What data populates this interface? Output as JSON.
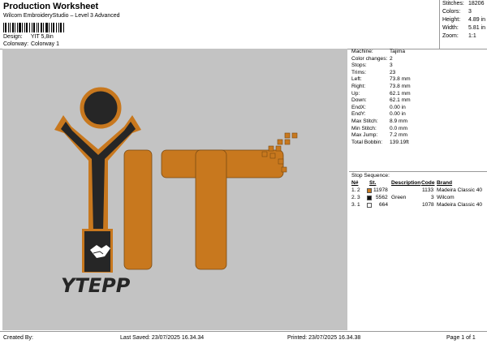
{
  "header": {
    "title": "Production Worksheet",
    "subtitle": "Wilcom EmbroideryStudio – Level 3 Advanced",
    "design_label": "Design:",
    "design_value": "YIT 5,8in",
    "colorway_label": "Colorway:",
    "colorway_value": "Colorway 1"
  },
  "stats": [
    {
      "label": "Stitches:",
      "value": "18206"
    },
    {
      "label": "Colors:",
      "value": "3"
    },
    {
      "label": "Height:",
      "value": "4.89 in"
    },
    {
      "label": "Width:",
      "value": "5.81 in"
    },
    {
      "label": "Zoom:",
      "value": "1:1"
    }
  ],
  "specs": [
    {
      "label": "Machine:",
      "value": "Tajima"
    },
    {
      "label": "Color changes:",
      "value": "2"
    },
    {
      "label": "Stops:",
      "value": "3"
    },
    {
      "label": "Trims:",
      "value": "23"
    },
    {
      "label": "Left:",
      "value": "73.8 mm"
    },
    {
      "label": "Right:",
      "value": "73.8 mm"
    },
    {
      "label": "Up:",
      "value": "62.1 mm"
    },
    {
      "label": "Down:",
      "value": "62.1 mm"
    },
    {
      "label": "EndX:",
      "value": "0.00 in"
    },
    {
      "label": "EndY:",
      "value": "0.00 in"
    },
    {
      "label": "Max Stitch:",
      "value": "8.9 mm"
    },
    {
      "label": "Min Stitch:",
      "value": "0.0 mm"
    },
    {
      "label": "Max Jump:",
      "value": "7.2 mm"
    },
    {
      "label": "Total Bobbin:",
      "value": "139.19ft"
    }
  ],
  "stop_sequence": {
    "title": "Stop Sequence:",
    "columns": [
      "N#",
      "St.",
      "Description",
      "Code",
      "Brand"
    ],
    "rows": [
      {
        "num": "1.",
        "stop": "2",
        "color": "#c87a1e",
        "code_no": "11978",
        "description": "",
        "code": "1133",
        "brand": "Madeira Classic 40"
      },
      {
        "num": "2.",
        "stop": "3",
        "color": "#111111",
        "code_no": "5562",
        "description": "Green",
        "code": "3",
        "brand": "Wilcom"
      },
      {
        "num": "3.",
        "stop": "1",
        "color": "#ffffff",
        "code_no": "664",
        "description": "",
        "code": "1078",
        "brand": "Madeira Classic 40"
      }
    ]
  },
  "design": {
    "logo_text": "YTEPP",
    "colors": {
      "orange": "#c8781e",
      "dark": "#262626",
      "background": "#c3c3c3"
    }
  },
  "footer": {
    "created_by": "Created By:",
    "last_saved": "Last Saved: 23/07/2025 16.34.34",
    "printed": "Printed: 23/07/2025 16.34.38",
    "page": "Page 1 of 1"
  }
}
